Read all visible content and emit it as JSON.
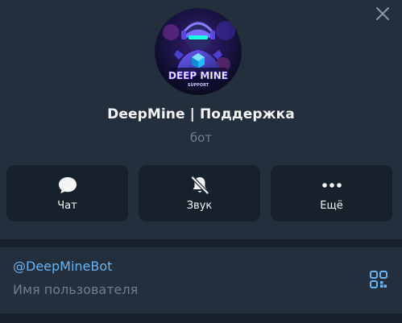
{
  "profile": {
    "name": "DeepMine | Поддержка",
    "subtitle": "бот",
    "avatar_text_top": "DEEP MINE",
    "avatar_text_bottom": "SUPPORT"
  },
  "actions": [
    {
      "label": "Чат",
      "icon": "chat-bubble-icon"
    },
    {
      "label": "Звук",
      "icon": "bell-muted-icon"
    },
    {
      "label": "Ещё",
      "icon": "more-dots-icon"
    }
  ],
  "info": {
    "username": "@DeepMineBot",
    "username_caption": "Имя пользователя"
  },
  "colors": {
    "background": "#17212b",
    "panel": "#242f3d",
    "accent": "#6ab3f3",
    "muted": "#6d7f8f"
  }
}
